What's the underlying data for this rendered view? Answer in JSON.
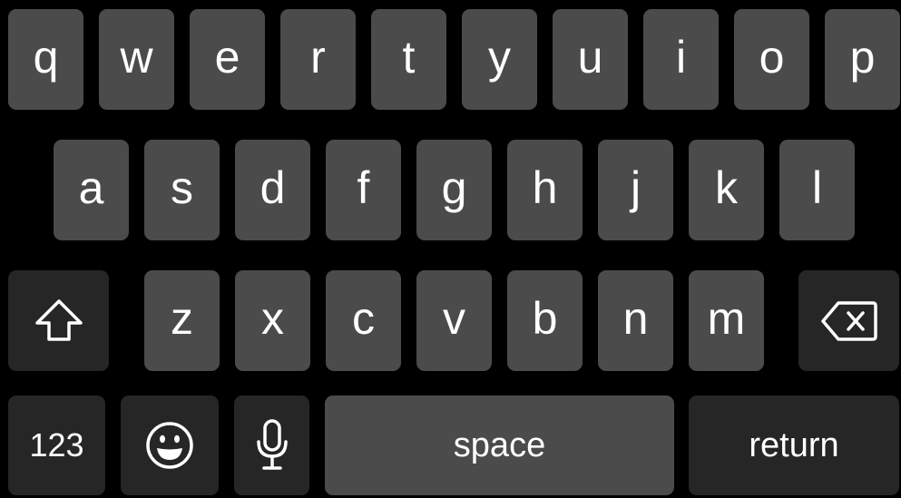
{
  "keyboard": {
    "row1": [
      "q",
      "w",
      "e",
      "r",
      "t",
      "y",
      "u",
      "i",
      "o",
      "p"
    ],
    "row2": [
      "a",
      "s",
      "d",
      "f",
      "g",
      "h",
      "j",
      "k",
      "l"
    ],
    "row3": [
      "z",
      "x",
      "c",
      "v",
      "b",
      "n",
      "m"
    ],
    "shift_icon": "shift-arrow-icon",
    "delete_icon": "backspace-delete-icon",
    "numbers_label": "123",
    "emoji_icon": "smiley-face-icon",
    "mic_icon": "microphone-icon",
    "space_label": "space",
    "return_label": "return"
  },
  "colors": {
    "background": "#000000",
    "letter_key": "#4b4b4b",
    "function_key": "#262626",
    "text": "#ffffff"
  }
}
